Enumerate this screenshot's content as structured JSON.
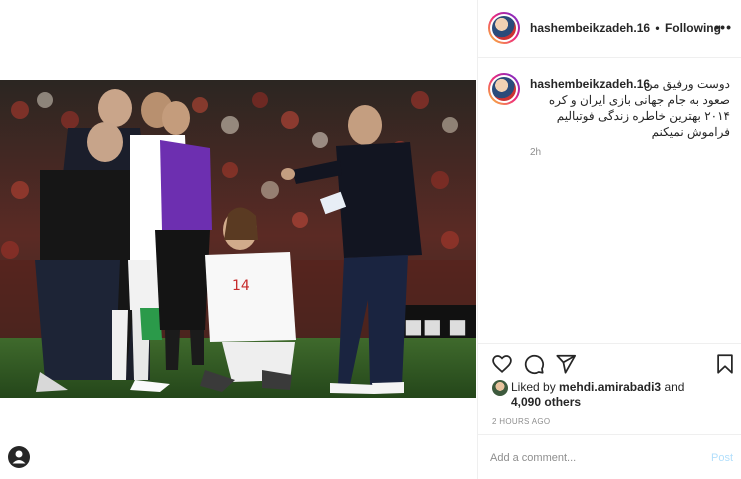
{
  "post": {
    "username": "hashembeikzadeh.16",
    "separator": "•",
    "follow_status": "Following",
    "more_icon": "more-horizontal-icon",
    "caption_text": "دوست ورفیق من\nصعود به جام جهانی بازی ایران و کره\n۲۰۱۴ بهترین خاطره زندگی فوتبالیم\nفراموش نمیکنم",
    "caption_time": "2h",
    "liked_by_prefix": "Liked by",
    "liked_by_user": "mehdi.amirabadi3",
    "liked_by_and": "and",
    "liked_by_others": "4,090 others",
    "posted_ago": "2 HOURS AGO"
  },
  "comment": {
    "placeholder": "Add a comment...",
    "post_label": "Post"
  },
  "actions": {
    "like_icon": "heart-icon",
    "comment_icon": "comment-icon",
    "share_icon": "paper-plane-icon",
    "save_icon": "bookmark-icon"
  },
  "colors": {
    "text": "#262626",
    "muted": "#8e8e8e",
    "border": "#efefef",
    "post_disabled": "#b2dffc"
  }
}
